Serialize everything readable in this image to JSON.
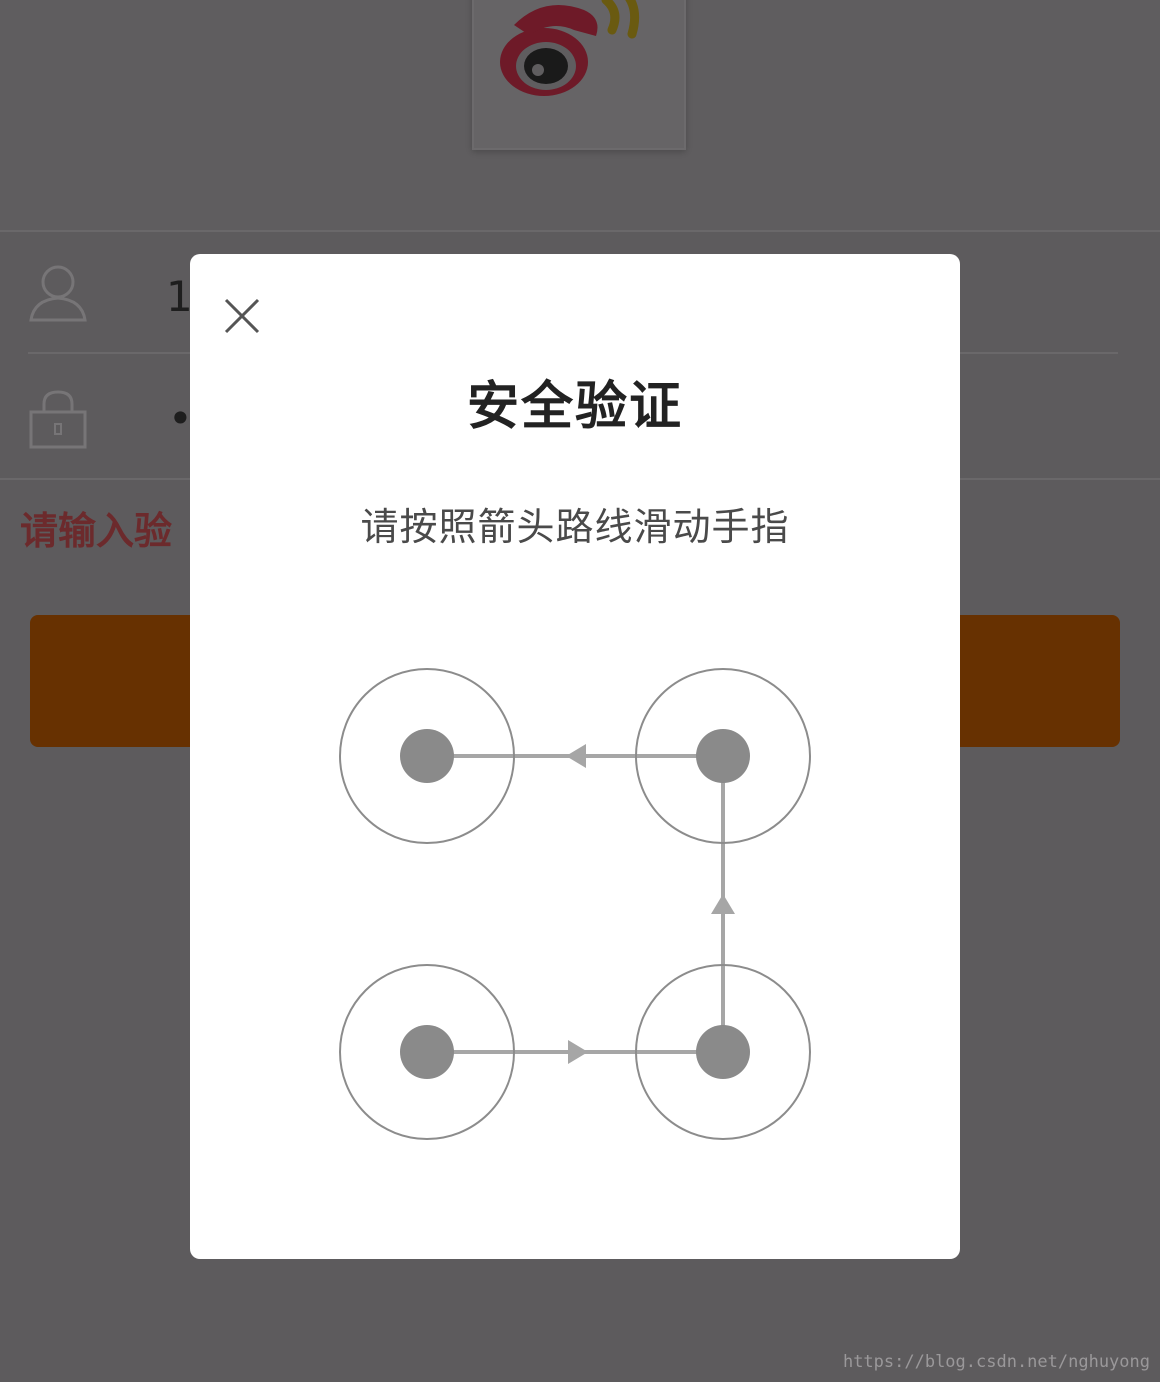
{
  "background": {
    "logo": {
      "icon": "weibo-logo-icon"
    },
    "username_field": {
      "icon": "user-icon",
      "value": "1"
    },
    "password_field": {
      "icon": "lock-icon",
      "value": "•"
    },
    "hint_text": "请输入验",
    "login_button": {
      "label": ""
    }
  },
  "modal": {
    "close_icon": "close-icon",
    "title": "安全验证",
    "subtitle": "请按照箭头路线滑动手指",
    "pattern": {
      "grid": "2x2",
      "path": [
        "bottom-left",
        "bottom-right",
        "top-right",
        "top-left"
      ]
    }
  },
  "watermark": "https://blog.csdn.net/nghuyong",
  "colors": {
    "overlay": "#5d5b5d",
    "modal_bg": "#ffffff",
    "title": "#222222",
    "dot": "#8a8a8a",
    "ring": "#8c8c8c",
    "path": "#a6a6a6",
    "weibo_red": "#6e1a28",
    "weibo_yellow": "#6a5a10",
    "button": "#673101",
    "hint": "#6c2a2c"
  }
}
